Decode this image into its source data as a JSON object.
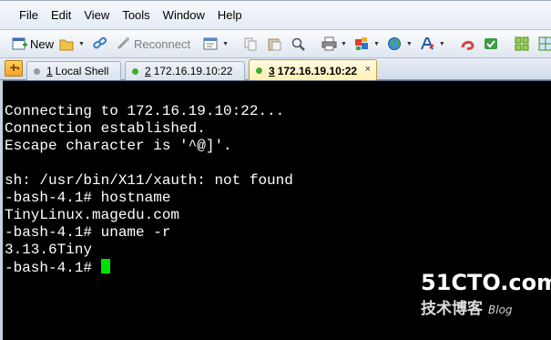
{
  "menu": [
    "File",
    "Edit",
    "View",
    "Tools",
    "Window",
    "Help"
  ],
  "toolbar": {
    "new_label": "New",
    "reconnect_label": "Reconnect"
  },
  "tabs": [
    {
      "num": "1",
      "label": "Local Shell",
      "status_color": "#9a9a9a",
      "active": false
    },
    {
      "num": "2",
      "label": "172.16.19.10:22",
      "status_color": "#3fae2a",
      "active": false
    },
    {
      "num": "3",
      "label": "172.16.19.10:22",
      "status_color": "#3fae2a",
      "active": true
    }
  ],
  "tab_close_glyph": "×",
  "terminal": {
    "lines": [
      "Connecting to 172.16.19.10:22...",
      "Connection established.",
      "Escape character is '^@]'.",
      "",
      "sh: /usr/bin/X11/xauth: not found",
      "-bash-4.1# hostname",
      "TinyLinux.magedu.com",
      "-bash-4.1# uname -r",
      "3.13.6Tiny",
      "-bash-4.1# "
    ],
    "cursor_color": "#00e000"
  },
  "watermark": {
    "logo": "51CTO.com",
    "subtitle": "技术博客",
    "blog": "Blog"
  }
}
